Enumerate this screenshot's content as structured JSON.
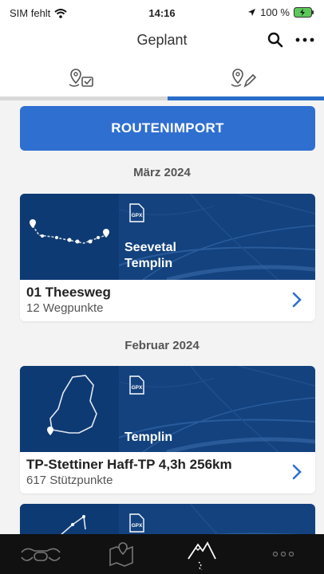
{
  "status": {
    "carrier": "SIM fehlt",
    "time": "14:16",
    "battery": "100 %"
  },
  "nav": {
    "title": "Geplant"
  },
  "tabs": [
    {
      "icon": "route-checked-icon",
      "active": false
    },
    {
      "icon": "route-edit-icon",
      "active": true
    }
  ],
  "import_button": {
    "label": "ROUTENIMPORT"
  },
  "sections": [
    {
      "label": "März 2024"
    },
    {
      "label": "Februar 2024"
    }
  ],
  "routes": [
    {
      "badge": "GPX",
      "start": "Seevetal",
      "end": "Templin",
      "name": "01 Theesweg",
      "detail": "12 Wegpunkte"
    },
    {
      "badge": "GPX",
      "start": "",
      "end": "Templin",
      "name": "TP-Stettiner Haff-TP 4,3h 256km",
      "detail": "617 Stützpunkte"
    },
    {
      "badge": "GPX"
    }
  ],
  "colors": {
    "accent": "#2f6fd0",
    "card_banner": "#13427f",
    "tabbar": "#111111"
  }
}
